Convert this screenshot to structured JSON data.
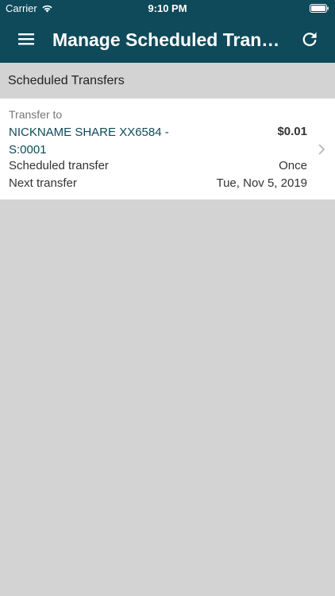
{
  "status_bar": {
    "carrier": "Carrier",
    "time": "9:10 PM",
    "icons": [
      "wifi-icon",
      "battery-icon"
    ]
  },
  "nav": {
    "title": "Manage Scheduled Transf...",
    "menu_icon": "hamburger-menu-icon",
    "refresh_icon": "refresh-icon"
  },
  "section": {
    "title": "Scheduled Transfers"
  },
  "transfer": {
    "to_label": "Transfer to",
    "to_name": "NICKNAME SHARE XX6584 - S:0001",
    "amount": "$0.01",
    "schedule_label": "Scheduled transfer",
    "schedule_value": "Once",
    "next_label": "Next transfer",
    "next_value": "Tue, Nov 5, 2019"
  },
  "colors": {
    "header_bg": "#0e4a5a",
    "accent_text": "#0e4a5a",
    "page_bg": "#d3d3d3",
    "card_bg": "#ffffff"
  }
}
